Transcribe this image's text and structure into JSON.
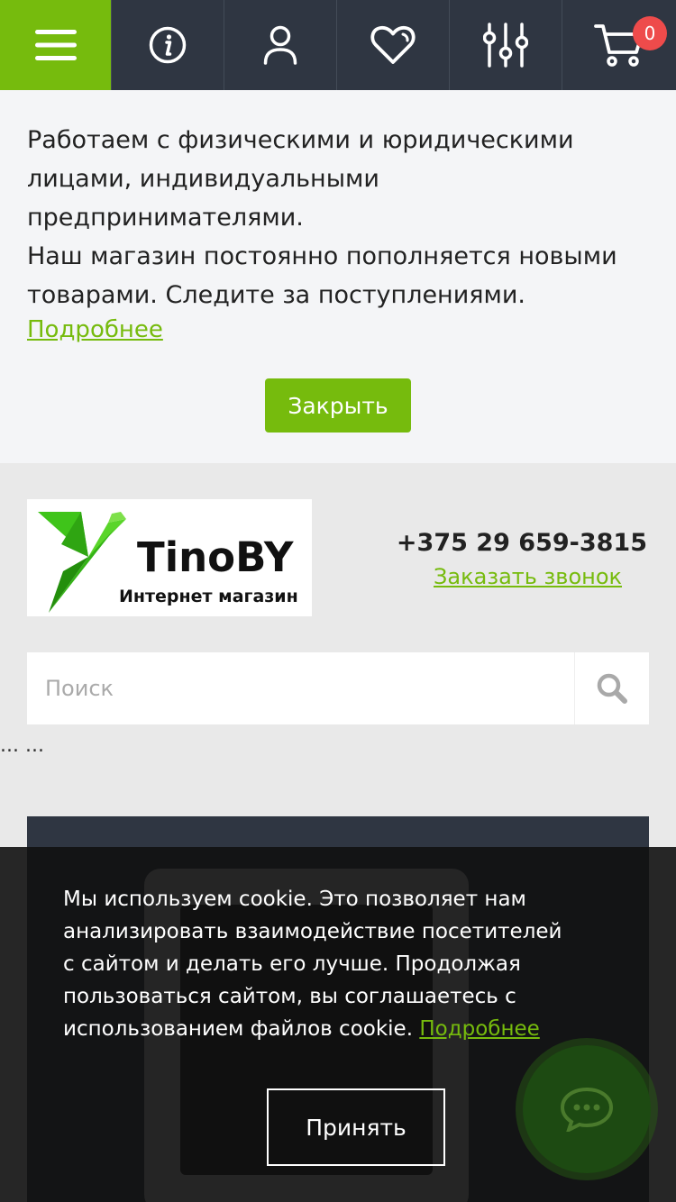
{
  "topbar": {
    "menu_icon": "hamburger-icon",
    "info_icon": "info-icon",
    "user_icon": "user-icon",
    "favorites_icon": "heart-icon",
    "compare_icon": "sliders-icon",
    "cart_icon": "cart-icon",
    "cart_count": "0"
  },
  "info": {
    "line1": "Работаем с физическими и юридическими лицами, индивидуальными предпринимателями.",
    "line2": "Наш магазин постоянно пополняется новыми товарами. Следите за поступлениями.",
    "more_link": "Подробнее",
    "close_button": "Закрыть"
  },
  "header": {
    "logo_brand": "TinoBY",
    "logo_sub": "Интернет магазин",
    "phone": "+375 29 659-3815",
    "callback_link": "Заказать звонок"
  },
  "search": {
    "placeholder": "Поиск"
  },
  "breadcrumb_dots": "... ...",
  "cookie": {
    "text": "Мы используем cookie. Это позволяет нам анализировать взаимодействие посетителей с сайтом и делать его лучше. Продолжая пользоваться сайтом, вы соглашаетесь с использованием файлов cookie.",
    "more_link": "Подробнее",
    "accept_button": "Принять"
  },
  "colors": {
    "accent": "#76bb0d",
    "topbar": "#2f3642",
    "badge": "#ee4b4b"
  }
}
